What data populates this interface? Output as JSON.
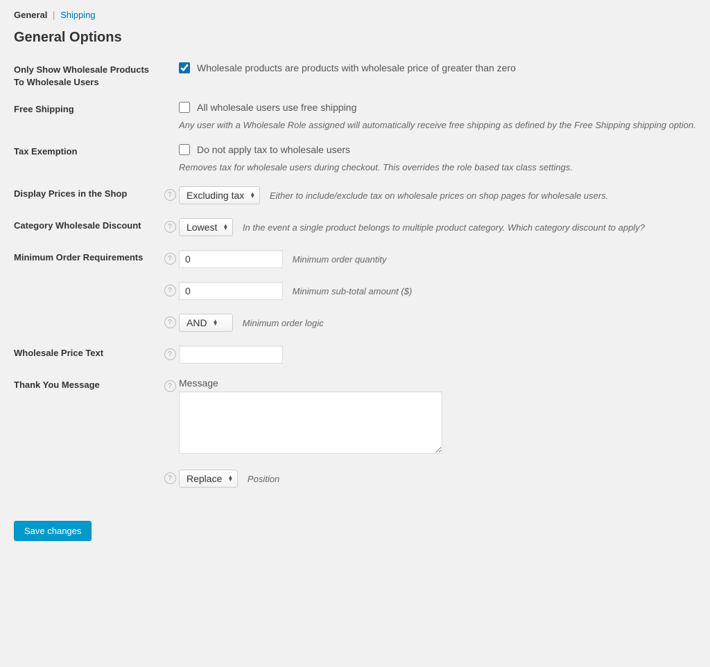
{
  "tabs": {
    "general": "General",
    "shipping": "Shipping"
  },
  "page_title": "General Options",
  "rows": {
    "only_wholesale": {
      "label": "Only Show Wholesale Products To Wholesale Users",
      "checkbox_label": "Wholesale products are products with wholesale price of greater than zero",
      "checked": true
    },
    "free_shipping": {
      "label": "Free Shipping",
      "checkbox_label": "All wholesale users use free shipping",
      "hint": "Any user with a Wholesale Role assigned will automatically receive free shipping as defined by the Free Shipping shipping option.",
      "checked": false
    },
    "tax_exemption": {
      "label": "Tax Exemption",
      "checkbox_label": "Do not apply tax to wholesale users",
      "hint": "Removes tax for wholesale users during checkout. This overrides the role based tax class settings.",
      "checked": false
    },
    "display_prices": {
      "label": "Display Prices in the Shop",
      "select_value": "Excluding tax",
      "hint": "Either to include/exclude tax on wholesale prices on shop pages for wholesale users."
    },
    "category_discount": {
      "label": "Category Wholesale Discount",
      "select_value": "Lowest",
      "hint": "In the event a single product belongs to multiple product category. Which category discount to apply?"
    },
    "min_order": {
      "label": "Minimum Order Requirements",
      "qty_value": "0",
      "qty_hint": "Minimum order quantity",
      "subtotal_value": "0",
      "subtotal_hint": "Minimum sub-total amount ($)",
      "logic_value": "AND",
      "logic_hint": "Minimum order logic"
    },
    "price_text": {
      "label": "Wholesale Price Text",
      "value": ""
    },
    "thank_you": {
      "label": "Thank You Message",
      "sub_label": "Message",
      "value": "",
      "position_value": "Replace",
      "position_hint": "Position"
    }
  },
  "save_button": "Save changes"
}
